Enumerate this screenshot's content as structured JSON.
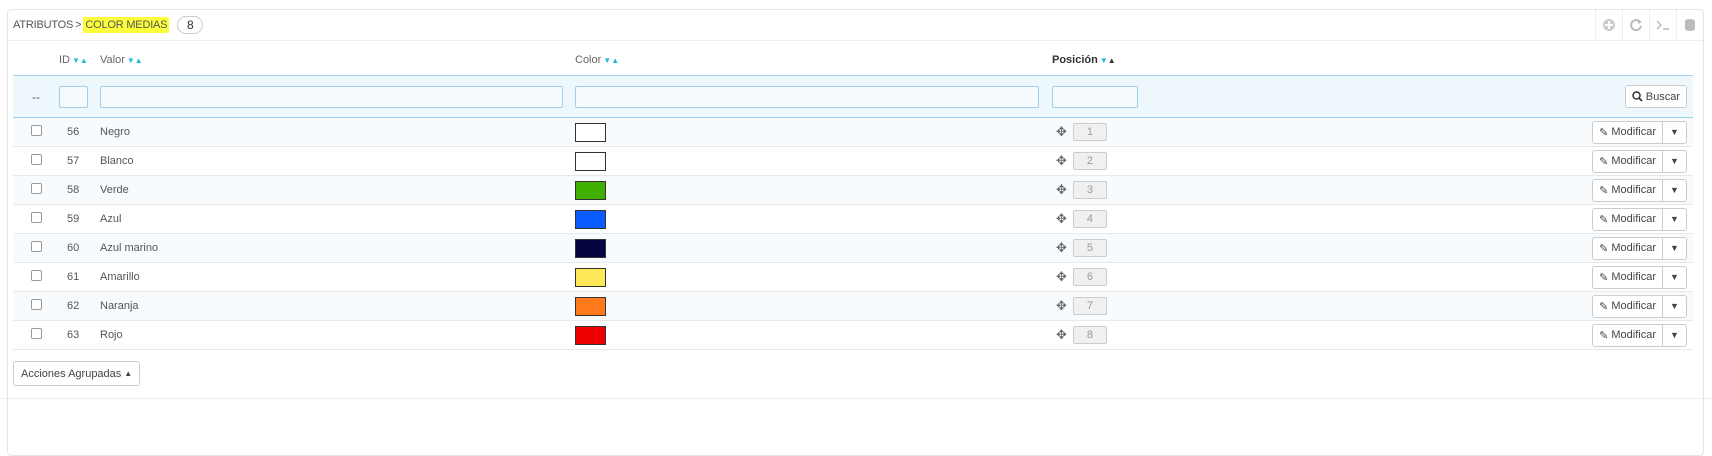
{
  "breadcrumb": {
    "parent": "ATRIBUTOS",
    "separator": ">",
    "current": "COLOR MEDIAS",
    "count": "8"
  },
  "toolbar": {
    "icons": [
      "add-icon",
      "refresh-icon",
      "terminal-icon",
      "database-icon"
    ]
  },
  "columns": {
    "id": "ID",
    "valor": "Valor",
    "color": "Color",
    "posicion": "Posición"
  },
  "filter": {
    "dash": "--",
    "search_label": "Buscar"
  },
  "rows": [
    {
      "id": "56",
      "valor": "Negro",
      "color": "#ffffff",
      "position": "1"
    },
    {
      "id": "57",
      "valor": "Blanco",
      "color": "#ffffff",
      "position": "2"
    },
    {
      "id": "58",
      "valor": "Verde",
      "color": "#40b000",
      "position": "3"
    },
    {
      "id": "59",
      "valor": "Azul",
      "color": "#0a5bff",
      "position": "4"
    },
    {
      "id": "60",
      "valor": "Azul marino",
      "color": "#070540",
      "position": "5"
    },
    {
      "id": "61",
      "valor": "Amarillo",
      "color": "#ffe858",
      "position": "6"
    },
    {
      "id": "62",
      "valor": "Naranja",
      "color": "#ff7a1a",
      "position": "7"
    },
    {
      "id": "63",
      "valor": "Rojo",
      "color": "#ee0000",
      "position": "8"
    }
  ],
  "row_action": {
    "edit_label": "Modificar"
  },
  "bulk": {
    "label": "Acciones Agrupadas"
  }
}
